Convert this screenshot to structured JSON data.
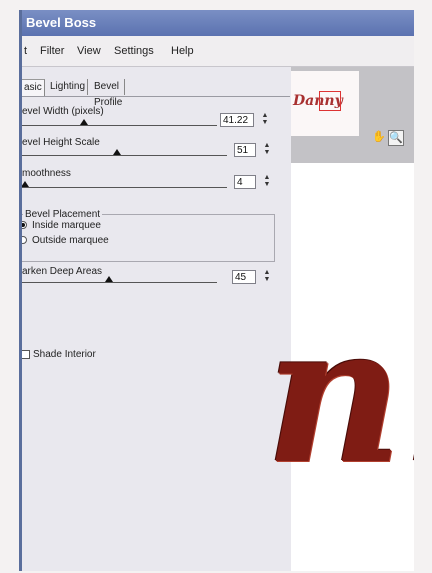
{
  "window": {
    "title": "Bevel Boss"
  },
  "menu": {
    "items": [
      "t",
      "Filter",
      "View",
      "Settings",
      "Help"
    ]
  },
  "tabs": {
    "items": [
      "asic",
      "Lighting",
      "Bevel Profile"
    ]
  },
  "controls": {
    "bevel_width": {
      "label": "evel Width (pixels)",
      "value": "41.22",
      "level": 0.3
    },
    "bevel_height": {
      "label": "evel Height Scale",
      "value": "51",
      "level": 0.45
    },
    "smoothness": {
      "label": "moothness",
      "value": "4",
      "level": 0.0
    },
    "darken": {
      "label": "arken Deep Areas",
      "value": "45",
      "level": 0.43
    }
  },
  "placement": {
    "legend": "Bevel Placement",
    "options": [
      "Inside marquee",
      "Outside marquee"
    ],
    "selected": "Inside marquee"
  },
  "shade_interior": {
    "label": "Shade Interior",
    "checked": false
  },
  "preview": {
    "thumbnail_text": "Danny",
    "canvas_text": "nn"
  },
  "colors": {
    "title_bar": "#5b72b0",
    "text_fill": "#7f1c14"
  }
}
